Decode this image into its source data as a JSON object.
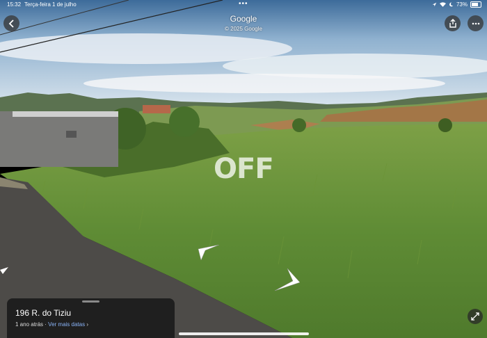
{
  "status_bar": {
    "time": "15:32",
    "date": "Terça-feira 1 de julho",
    "battery": "73%",
    "battery_level": 0.73
  },
  "header": {
    "title": "Google",
    "copyright": "© 2025 Google"
  },
  "watermark": "OFF",
  "info_card": {
    "address": "196 R. do Tiziu",
    "age": "1 ano atrás",
    "separator": "·",
    "link": "Ver mais datas",
    "chevron": "›"
  },
  "icons": {
    "back": "back-icon",
    "share": "share-icon",
    "more": "more-icon",
    "expand": "expand-icon",
    "nav_arrow": "navigation-arrow-icon"
  },
  "colors": {
    "card_bg": "#1f1f1f",
    "link": "#8ab4f8"
  }
}
